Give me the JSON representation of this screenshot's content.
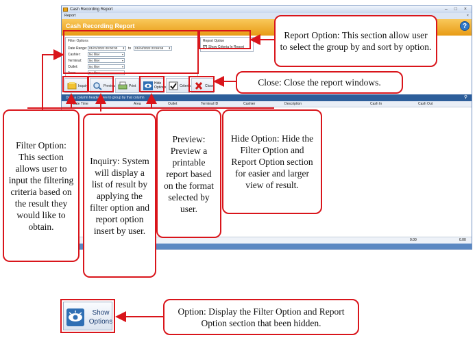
{
  "window": {
    "title": "Cash Recording Report",
    "menu": "Report",
    "window_controls": "– □ ×",
    "menu_close": "×",
    "header": "Cash Recording Report",
    "help_icon_glyph": "?"
  },
  "filter_options": {
    "title": "Filter Options",
    "date_range_label": "Date Range:",
    "date_from": "01/01/2022 00:00:00",
    "to_label": "to",
    "date_to": "01/04/2022 23:59:59",
    "cashier_label": "Cashier:",
    "terminal_label": "Terminal:",
    "outlet_label": "Outlet:",
    "area_label": "Area:",
    "no_filter": "No filter"
  },
  "report_option": {
    "title": "Report Option",
    "show_criteria_label": "Show Criteria In Report",
    "show_criteria_checked": true,
    "check_glyph": "✓"
  },
  "toolbar": {
    "inquiry": "Inquiry",
    "preview": "Preview",
    "print": "Print",
    "hide_options_1": "Hide",
    "hide_options_2": "Options",
    "criteria": "Criteria",
    "close": "Close"
  },
  "grid": {
    "group_panel_text": "Drag a column header here to group by that column",
    "columns": [
      "Date Time",
      "Area",
      "Outlet",
      "Terminal ID",
      "Cashier",
      "Description",
      "Cash In",
      "Cash Out"
    ],
    "totals": [
      "0.00",
      "0.00"
    ]
  },
  "callouts": {
    "report_option": "Report Option: This section allow user to select the group by and sort by option.",
    "close": "Close: Close the report windows.",
    "filter_option": "Filter Option: This section allows user to input the filtering criteria based on the result they would like to obtain.",
    "inquiry": "Inquiry: System will display a list of result by applying the filter option and report option insert by user.",
    "preview": "Preview: Preview a printable report based on the format selected by user.",
    "hide_option": "Hide Option: Hide the Filter Option and Report Option section for easier and larger view of result.",
    "show_option": "Option: Display the Filter Option and Report Option section that been hidden."
  },
  "show_options_button": {
    "line1": "Show",
    "line2": "Options"
  },
  "colors": {
    "highlight_red": "#d9151b",
    "header_orange": "#f0a52a",
    "grid_blue": "#2d5e9a"
  }
}
